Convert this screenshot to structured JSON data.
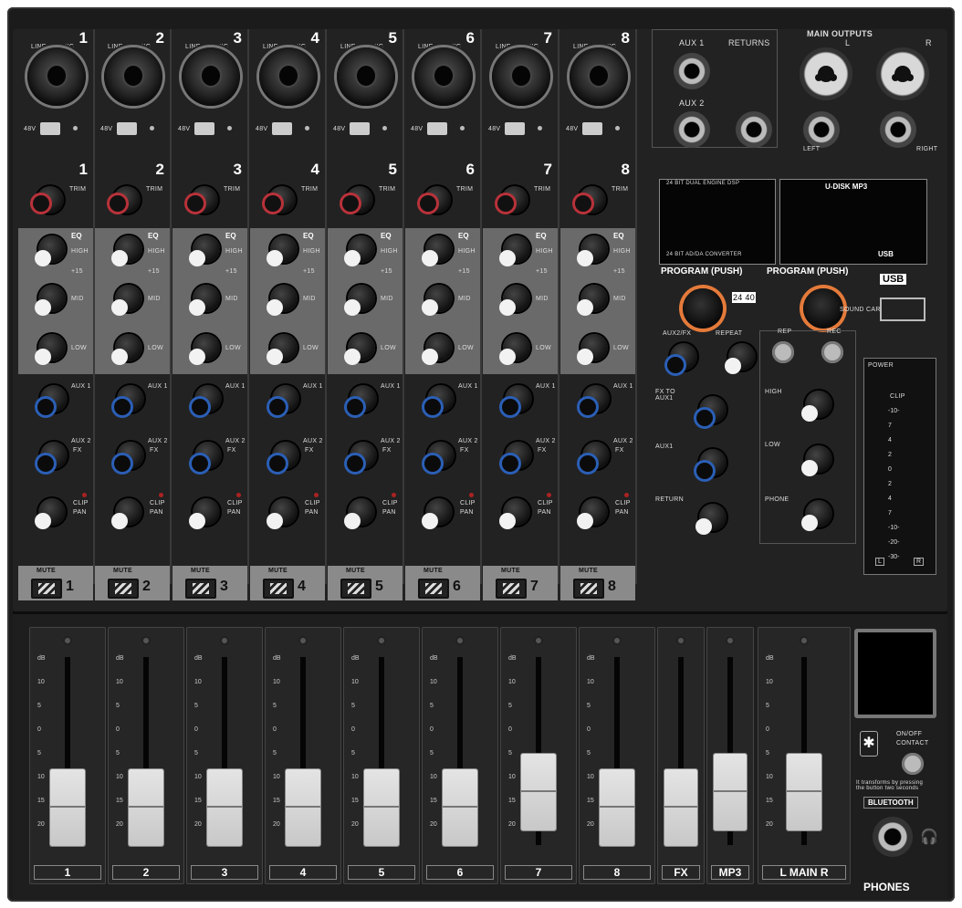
{
  "channels": [
    {
      "num": "1",
      "mute_num": "1",
      "fader": "1",
      "red_knob": true
    },
    {
      "num": "2",
      "mute_num": "2",
      "fader": "2",
      "red_knob": true
    },
    {
      "num": "3",
      "mute_num": "3",
      "fader": "3",
      "red_knob": true
    },
    {
      "num": "4",
      "mute_num": "4",
      "fader": "4",
      "red_knob": true
    },
    {
      "num": "5",
      "mute_num": "5",
      "fader": "5",
      "red_knob": true
    },
    {
      "num": "6",
      "mute_num": "6",
      "fader": "6",
      "red_knob": true
    },
    {
      "num": "7",
      "mute_num": "7",
      "fader": "7",
      "red_knob": true
    },
    {
      "num": "8",
      "mute_num": "8",
      "fader": "8",
      "red_knob": true
    }
  ],
  "channel_labels": {
    "input": "LINE IN / MIC",
    "phantom": "48V",
    "trim": "TRIM",
    "eq": "EQ",
    "high": "HIGH",
    "mid": "MID",
    "low": "LOW",
    "aux1": "AUX 1",
    "aux2": "AUX 2",
    "fx": "FX",
    "clip": "CLIP",
    "pan": "PAN",
    "mute": "MUTE",
    "plus15": "+15"
  },
  "master": {
    "aux1": "AUX 1",
    "aux2": "AUX 2",
    "returns": "RETURNS",
    "main_outputs": "MAIN OUTPUTS",
    "left": "LEFT",
    "right": "RIGHT",
    "l": "L",
    "r": "R",
    "dsp": "24 BIT DUAL ENGINE DSP",
    "converter": "24 BIT AD/DA CONVERTER",
    "udisk": "U-DISK MP3",
    "usb": "USB",
    "program1": "PROGRAM (PUSH)",
    "program2": "PROGRAM (PUSH)",
    "badge": "24 40",
    "soundcard": "SOUND CARD",
    "aux2fx": "AUX2/FX",
    "repeat": "REPEAT",
    "fx_to_aux1": "FX TO AUX1",
    "aux1_ret": "AUX1",
    "return": "RETURN",
    "rep": "REP",
    "rec": "REC",
    "high": "HIGH",
    "low": "LOW",
    "phone": "PHONE",
    "power": "POWER",
    "clip": "CLIP"
  },
  "meter_ticks": [
    "-10-",
    "7",
    "4",
    "2",
    "0",
    "2",
    "4",
    "7",
    "-10-",
    "-20-",
    "-30-"
  ],
  "faders": [
    {
      "label": "1",
      "pos": 0.8
    },
    {
      "label": "2",
      "pos": 0.8
    },
    {
      "label": "3",
      "pos": 0.8
    },
    {
      "label": "4",
      "pos": 0.8
    },
    {
      "label": "5",
      "pos": 0.8
    },
    {
      "label": "6",
      "pos": 0.8
    },
    {
      "label": "7",
      "pos": 0.72
    },
    {
      "label": "8",
      "pos": 0.8
    },
    {
      "label": "FX",
      "pos": 0.8
    },
    {
      "label": "MP3",
      "pos": 0.72
    },
    {
      "label": "L MAIN R",
      "pos": 0.72
    }
  ],
  "fader_scale": [
    "dB",
    "10",
    "5",
    "0",
    "5",
    "10",
    "15",
    "20"
  ],
  "right_panel": {
    "onoff": "ON/OFF",
    "contact": "CONTACT",
    "bt_text": "It transforms by pressing the button two seconds",
    "bluetooth": "BLUETOOTH",
    "phones": "PHONES"
  }
}
